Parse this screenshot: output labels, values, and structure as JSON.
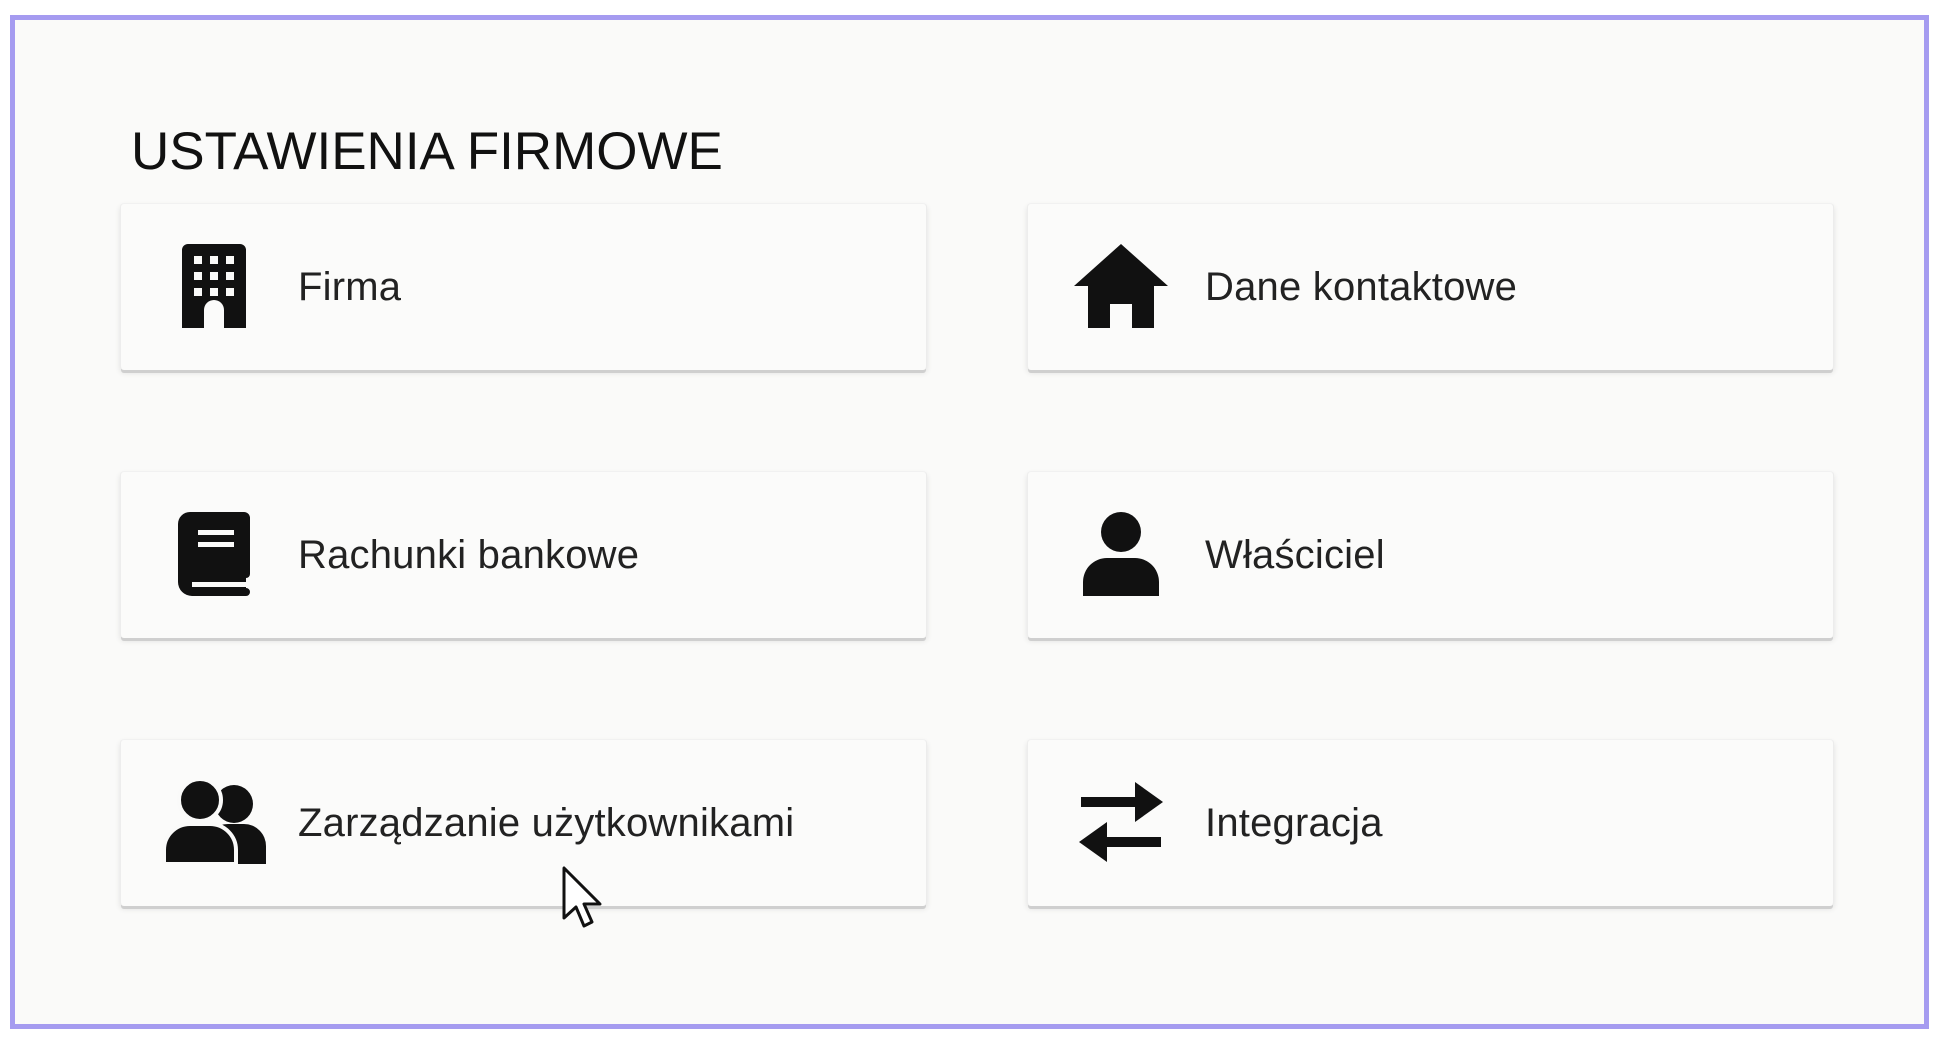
{
  "page": {
    "title": "USTAWIENIA FIRMOWE"
  },
  "cards": [
    {
      "label": "Firma",
      "icon": "building-icon"
    },
    {
      "label": "Dane kontaktowe",
      "icon": "house-icon"
    },
    {
      "label": "Rachunki bankowe",
      "icon": "book-icon"
    },
    {
      "label": "Właściciel",
      "icon": "person-icon"
    },
    {
      "label": "Zarządzanie użytkownikami",
      "icon": "users-icon"
    },
    {
      "label": "Integracja",
      "icon": "swap-arrows-icon"
    }
  ],
  "colors": {
    "frame_border": "#a59bf0",
    "background": "#fafaf9",
    "icon": "#111111"
  }
}
